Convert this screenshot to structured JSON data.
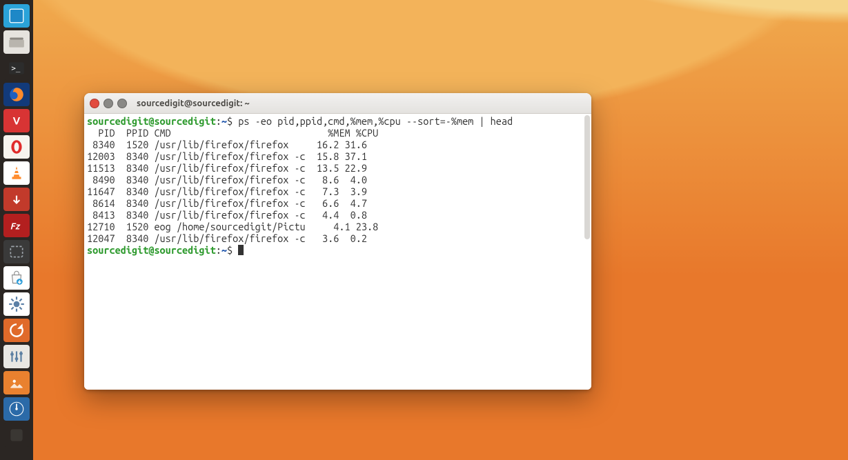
{
  "launcher": {
    "items": [
      {
        "name": "show-desktop",
        "bg": "#2aa3d9"
      },
      {
        "name": "files",
        "bg": "#e6e3de"
      },
      {
        "name": "terminal",
        "bg": "#2b2623"
      },
      {
        "name": "firefox",
        "bg": "#123a7a"
      },
      {
        "name": "vivaldi",
        "bg": "#d83434"
      },
      {
        "name": "opera",
        "bg": "#f7f4ef"
      },
      {
        "name": "vlc",
        "bg": "#ffffff"
      },
      {
        "name": "transmission",
        "bg": "#c23a2b"
      },
      {
        "name": "filezilla",
        "bg": "#b31f1f"
      },
      {
        "name": "screenshot",
        "bg": "#3a3a3a"
      },
      {
        "name": "software-center",
        "bg": "#ffffff"
      },
      {
        "name": "settings",
        "bg": "#ffffff"
      },
      {
        "name": "software-updater",
        "bg": "#e06a2a"
      },
      {
        "name": "tweaks",
        "bg": "#e9e7e3"
      },
      {
        "name": "image-viewer",
        "bg": "#e9812f"
      },
      {
        "name": "system-monitor",
        "bg": "#2b6aa8"
      },
      {
        "name": "app",
        "bg": "#2b2623"
      }
    ]
  },
  "window": {
    "title": "sourcedigit@sourcedigit: ~"
  },
  "prompt": {
    "userhost": "sourcedigit@sourcedigit",
    "sep": ":",
    "path": "~",
    "sigil": "$"
  },
  "command": "ps -eo pid,ppid,cmd,%mem,%cpu --sort=-%mem | head",
  "columns": [
    "PID",
    "PPID",
    "CMD",
    "%MEM",
    "%CPU"
  ],
  "rows": [
    {
      "pid": "8340",
      "ppid": "1520",
      "cmd": "/usr/lib/firefox/firefox",
      "cflag": "",
      "mem": "16.2",
      "cpu": "31.6"
    },
    {
      "pid": "12003",
      "ppid": "8340",
      "cmd": "/usr/lib/firefox/firefox",
      "cflag": "-c",
      "mem": "15.8",
      "cpu": "37.1"
    },
    {
      "pid": "11513",
      "ppid": "8340",
      "cmd": "/usr/lib/firefox/firefox",
      "cflag": "-c",
      "mem": "13.5",
      "cpu": "22.9"
    },
    {
      "pid": "8490",
      "ppid": "8340",
      "cmd": "/usr/lib/firefox/firefox",
      "cflag": "-c",
      "mem": "8.6",
      "cpu": "4.0"
    },
    {
      "pid": "11647",
      "ppid": "8340",
      "cmd": "/usr/lib/firefox/firefox",
      "cflag": "-c",
      "mem": "7.3",
      "cpu": "3.9"
    },
    {
      "pid": "8614",
      "ppid": "8340",
      "cmd": "/usr/lib/firefox/firefox",
      "cflag": "-c",
      "mem": "6.6",
      "cpu": "4.7"
    },
    {
      "pid": "8413",
      "ppid": "8340",
      "cmd": "/usr/lib/firefox/firefox",
      "cflag": "-c",
      "mem": "4.4",
      "cpu": "0.8"
    },
    {
      "pid": "12710",
      "ppid": "1520",
      "cmd": "eog /home/sourcedigit/Pictu",
      "cflag": "",
      "mem": "4.1",
      "cpu": "23.8"
    },
    {
      "pid": "12047",
      "ppid": "8340",
      "cmd": "/usr/lib/firefox/firefox",
      "cflag": "-c",
      "mem": "3.6",
      "cpu": "0.2"
    }
  ]
}
